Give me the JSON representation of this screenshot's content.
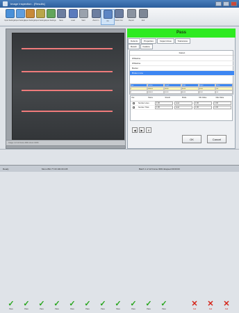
{
  "window": {
    "title": "Image Inspection - [Results]"
  },
  "toolbar": {
    "buttons": [
      {
        "label": "Input Settings",
        "color": "#4a90d9"
      },
      {
        "label": "Input Settings",
        "color": "#5f9ee0"
      },
      {
        "label": "Input Settings",
        "color": "#c88a3a"
      },
      {
        "label": "Input Settings",
        "color": "#b9a64a"
      },
      {
        "label": "Input Settings",
        "color": "#63a55b"
      },
      {
        "label": "Save",
        "color": "#6c7ea0"
      },
      {
        "label": "Load",
        "color": "#5b7bbd"
      },
      {
        "label": "Start",
        "color": "#9aa2ad"
      },
      {
        "label": "Zoom In",
        "color": "#6c7ea0"
      },
      {
        "label": "Fit",
        "color": "#5d86c4"
      },
      {
        "label": "Zoom Out",
        "color": "#6c7ea0"
      },
      {
        "label": "Report",
        "color": "#8a93a0"
      },
      {
        "label": "Exit",
        "color": "#7d8796"
      }
    ]
  },
  "filmstrip": {
    "label": "Image 1 of 12   Frame 0001   Zoom 100%"
  },
  "result": {
    "status": "Pass",
    "status_color": "#2eea21"
  },
  "tabs": [
    "Defects",
    "Properties",
    "Inspect Area",
    "Tolerances"
  ],
  "subtabs": [
    "Result",
    "Feature"
  ],
  "defects_table": {
    "header": "Defect",
    "rows": [
      {
        "label": "Whiteline",
        "selected": false
      },
      {
        "label": "Whiteline",
        "selected": false
      },
      {
        "label": "Border",
        "selected": false
      },
      {
        "label": "Broken Line",
        "selected": true
      }
    ]
  },
  "grid": {
    "columns": [
      "Type",
      "Position",
      "Length",
      "Width",
      "Height",
      "Value"
    ],
    "rows": [
      [
        "1",
        "0000.00",
        "00.00",
        "00.00",
        "00.00",
        "0.0"
      ],
      [
        "2",
        "0000.00",
        "00.00",
        "00.00",
        "00.00",
        "0.0"
      ]
    ]
  },
  "inspection": {
    "columns": [
      "Use",
      "Name",
      "Result",
      "Mode",
      "Min Value",
      "Max Value"
    ],
    "rows": [
      {
        "name": "Number Lines",
        "result": "1.00",
        "mode": "Less",
        "min": "1.00",
        "max": "1.00"
      },
      {
        "name": "Number Thick",
        "result": "1.00",
        "mode": "Less",
        "min": "1.00",
        "max": "1.00"
      }
    ]
  },
  "nav": [
    "◀",
    "▶",
    "✕"
  ],
  "buttons": {
    "ok": "OK",
    "cancel": "Cancel"
  },
  "thumbnails": [
    {
      "label": "Pass",
      "state": "pass"
    },
    {
      "label": "Pass",
      "state": "pass"
    },
    {
      "label": "Pass",
      "state": "pass"
    },
    {
      "label": "Pass",
      "state": "pass"
    },
    {
      "label": "Pass",
      "state": "pass"
    },
    {
      "label": "Pass",
      "state": "pass"
    },
    {
      "label": "Pass",
      "state": "pass"
    },
    {
      "label": "Pass",
      "state": "pass"
    },
    {
      "label": "Pass",
      "state": "pass"
    },
    {
      "label": "Pass",
      "state": "pass"
    },
    {
      "label": "Pass",
      "state": "pass"
    },
    {
      "label": "Fail",
      "state": "fail"
    },
    {
      "label": "Fail",
      "state": "fail"
    },
    {
      "label": "Fail",
      "state": "fail"
    }
  ],
  "status_bar": {
    "left": "Ready",
    "mid": "Mono 8bit  77.00  100.00  245",
    "right": "Batch 1 of 12  Frame 0001  Elapsed 00:00:00"
  }
}
